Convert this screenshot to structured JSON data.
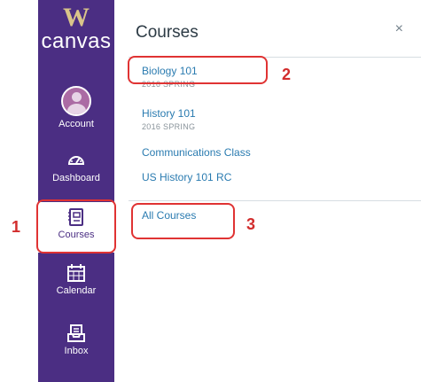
{
  "nav": {
    "logo_letter": "W",
    "logo_text": "canvas",
    "items": [
      {
        "label": "Account",
        "icon": "avatar"
      },
      {
        "label": "Dashboard",
        "icon": "speedometer-icon"
      },
      {
        "label": "Courses",
        "icon": "book-icon"
      },
      {
        "label": "Calendar",
        "icon": "calendar-icon"
      },
      {
        "label": "Inbox",
        "icon": "inbox-icon"
      }
    ],
    "color": "#4b2e83",
    "accent": "#d9c48a"
  },
  "tray": {
    "title": "Courses",
    "close_symbol": "×",
    "courses": [
      {
        "name": "Biology 101",
        "term": "2016 SPRING"
      },
      {
        "name": "History 101",
        "term": "2016 SPRING"
      },
      {
        "name": "Communications Class"
      },
      {
        "name": "US History 101 RC"
      }
    ],
    "all_courses": "All Courses",
    "link_color": "#2a7bb0"
  },
  "annotations": {
    "numbers": [
      "1",
      "2",
      "3"
    ],
    "color": "#e03333"
  }
}
